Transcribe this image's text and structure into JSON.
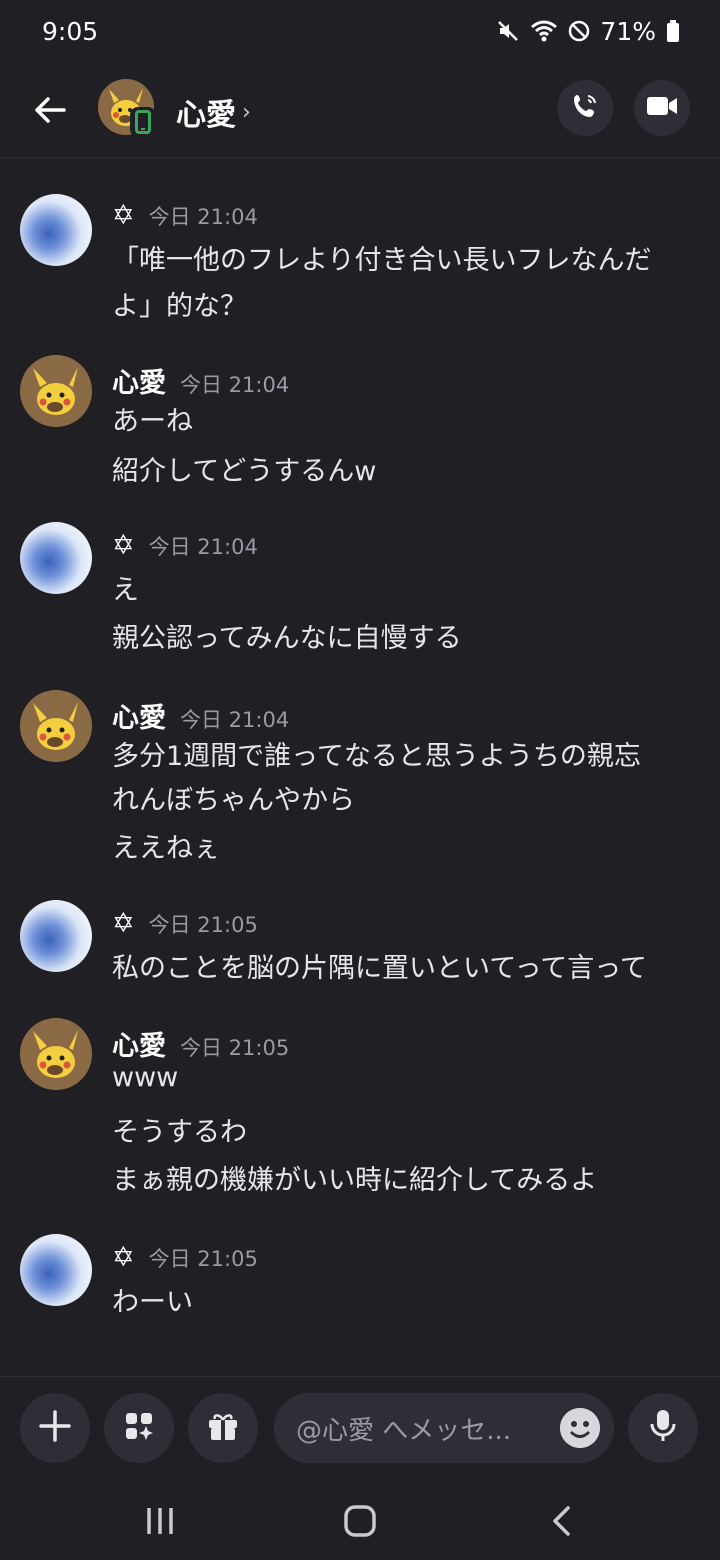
{
  "status": {
    "time": "9:05",
    "battery": "71%"
  },
  "header": {
    "title": "心愛",
    "chevron": "›"
  },
  "messages": [
    {
      "user": "✡",
      "time": "今日 21:04",
      "lines": [
        "「唯一他のフレより付き合い長いフレなんだ",
        "よ」的な？"
      ]
    },
    {
      "user": "心愛",
      "time": "今日 21:04",
      "lines": [
        "あーね",
        "紹介してどうするんw"
      ]
    },
    {
      "user": "✡",
      "time": "今日 21:04",
      "lines": [
        "え",
        "親公認ってみんなに自慢する"
      ]
    },
    {
      "user": "心愛",
      "time": "今日 21:04",
      "lines": [
        "多分1週間で誰ってなると思うようちの親忘",
        "れんぼちゃんやから",
        "ええねぇ"
      ]
    },
    {
      "user": "✡",
      "time": "今日 21:05",
      "lines": [
        "私のことを脳の片隅に置いといてって言って"
      ]
    },
    {
      "user": "心愛",
      "time": "今日 21:05",
      "lines": [
        "www",
        "そうするわ",
        "まぁ親の機嫌がいい時に紹介してみるよ"
      ]
    },
    {
      "user": "✡",
      "time": "今日 21:05",
      "lines": [
        "わーい"
      ]
    }
  ],
  "composer": {
    "placeholder": "@心愛 へメッセ..."
  }
}
